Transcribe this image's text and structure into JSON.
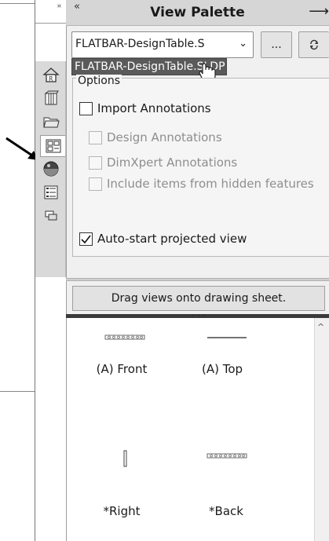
{
  "panel": {
    "title": "View Palette",
    "collapse_icon": "«",
    "pin_icon": "⟶"
  },
  "document_combo": {
    "value": "FLATBAR-DesignTable.S",
    "dropdown_item": "FLATBAR-DesignTable.SLDP"
  },
  "buttons": {
    "browse": "...",
    "refresh": "⟳",
    "close": "×"
  },
  "options": {
    "label": "Options",
    "import_annotations": {
      "label": "Import Annotations",
      "checked": false
    },
    "design_annotations": {
      "label": "Design Annotations",
      "checked": false,
      "enabled": false
    },
    "dimxpert_annotations": {
      "label": "DimXpert Annotations",
      "checked": false,
      "enabled": false
    },
    "hidden_features": {
      "label": "Include items from hidden features",
      "checked": false,
      "enabled": false
    },
    "auto_start": {
      "label": "Auto-start projected view",
      "checked": true
    }
  },
  "drag_button": "Drag views onto drawing sheet.",
  "views": [
    {
      "label": "(A) Front"
    },
    {
      "label": "(A) Top"
    },
    {
      "label": "*Right"
    },
    {
      "label": "*Back"
    }
  ],
  "tabs": [
    {
      "name": "home-icon"
    },
    {
      "name": "design-library-icon"
    },
    {
      "name": "file-explorer-icon"
    },
    {
      "name": "view-palette-icon"
    },
    {
      "name": "appearances-icon"
    },
    {
      "name": "custom-properties-icon"
    },
    {
      "name": "forum-icon"
    }
  ],
  "colors": {
    "titlebar": "#d6d6d6",
    "dropdown_highlight": "#5a5a5a",
    "panel_bg": "#f0f0f0"
  }
}
